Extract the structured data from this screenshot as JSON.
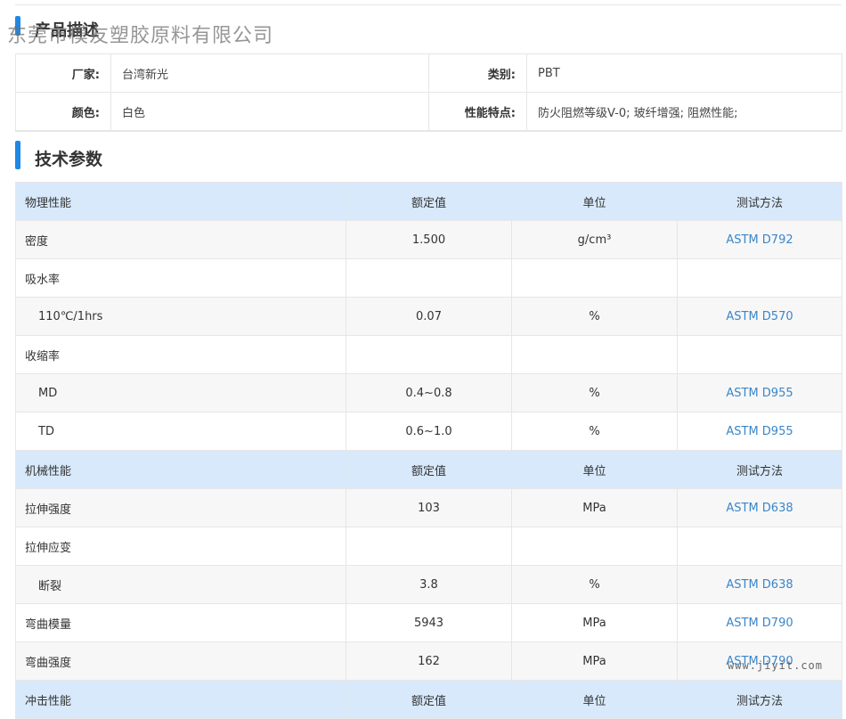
{
  "watermark": "东莞市模友塑胶原料有限公司",
  "desc": {
    "title": "产品描述",
    "rows": [
      {
        "l1": "厂家:",
        "v1": "台湾新光",
        "l2": "类别:",
        "v2": "PBT"
      },
      {
        "l1": "颜色:",
        "v1": "白色",
        "l2": "性能特点:",
        "v2": "防火阻燃等级V-0; 玻纤增强; 阻燃性能;"
      }
    ]
  },
  "tech": {
    "title": "技术参数",
    "header": {
      "value": "额定值",
      "unit": "单位",
      "method": "测试方法"
    },
    "groups": [
      {
        "name": "物理性能",
        "rows": [
          {
            "name": "密度",
            "value": "1.500",
            "unit": "g/cm³",
            "method": "ASTM D792"
          },
          {
            "name": "吸水率",
            "value": "",
            "unit": "",
            "method": ""
          },
          {
            "name": "110℃/1hrs",
            "value": "0.07",
            "unit": "%",
            "method": "ASTM D570",
            "sub": true
          },
          {
            "name": "收缩率",
            "value": "",
            "unit": "",
            "method": ""
          },
          {
            "name": "MD",
            "value": "0.4~0.8",
            "unit": "%",
            "method": "ASTM D955",
            "sub": true
          },
          {
            "name": "TD",
            "value": "0.6~1.0",
            "unit": "%",
            "method": "ASTM D955",
            "sub": true
          }
        ]
      },
      {
        "name": "机械性能",
        "rows": [
          {
            "name": "拉伸强度",
            "value": "103",
            "unit": "MPa",
            "method": "ASTM D638"
          },
          {
            "name": "拉伸应变",
            "value": "",
            "unit": "",
            "method": ""
          },
          {
            "name": "断裂",
            "value": "3.8",
            "unit": "%",
            "method": "ASTM D638",
            "sub": true
          },
          {
            "name": "弯曲模量",
            "value": "5943",
            "unit": "MPa",
            "method": "ASTM D790"
          },
          {
            "name": "弯曲强度",
            "value": "162",
            "unit": "MPa",
            "method": "ASTM D790"
          }
        ]
      },
      {
        "name": "冲击性能",
        "rows": []
      }
    ]
  },
  "footer_watermark": "www.jiyit.com"
}
